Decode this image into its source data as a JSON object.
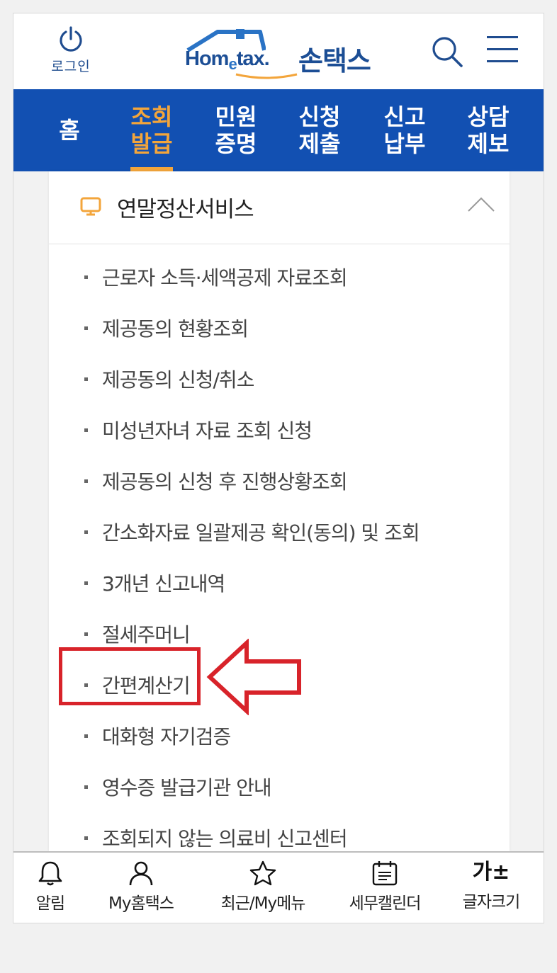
{
  "header": {
    "login_label": "로그인",
    "logo_en": "Hometax.",
    "logo_en_parts": [
      "Hom",
      "e",
      "tax."
    ],
    "logo_kor": "손택스",
    "search_icon": "search-icon",
    "menu_icon": "hamburger-icon"
  },
  "nav": {
    "items": [
      {
        "label": "홈",
        "active": false
      },
      {
        "label": "조회\n발급",
        "active": true
      },
      {
        "label": "민원\n증명",
        "active": false
      },
      {
        "label": "신청\n제출",
        "active": false
      },
      {
        "label": "신고\n납부",
        "active": false
      },
      {
        "label": "상담\n제보",
        "active": false
      }
    ],
    "bg_color": "#1250b2",
    "active_color": "#f3a53b"
  },
  "section": {
    "title": "연말정산서비스",
    "icon": "monitor-icon",
    "collapse_icon": "chevron-up-icon"
  },
  "menu_list": [
    "근로자 소득·세액공제 자료조회",
    "제공동의 현황조회",
    "제공동의 신청/취소",
    "미성년자녀 자료 조회 신청",
    "제공동의 신청 후 진행상황조회",
    "간소화자료 일괄제공 확인(동의) 및 조회",
    "3개년 신고내역",
    "절세주머니",
    "간편계산기",
    "대화형 자기검증",
    "영수증 발급기관 안내",
    "조회되지 않는 의료비 신고센터"
  ],
  "annotation": {
    "highlighted_item": "간편계산기",
    "color": "#d8232a"
  },
  "bottom_bar": {
    "items": [
      {
        "label": "알림",
        "icon": "bell-icon"
      },
      {
        "label": "My홈택스",
        "icon": "person-icon"
      },
      {
        "label": "최근/My메뉴",
        "icon": "star-icon"
      },
      {
        "label": "세무캘린더",
        "icon": "calendar-icon"
      },
      {
        "label": "글자크기",
        "icon": "font-size-icon",
        "glyph": "가±"
      }
    ]
  }
}
